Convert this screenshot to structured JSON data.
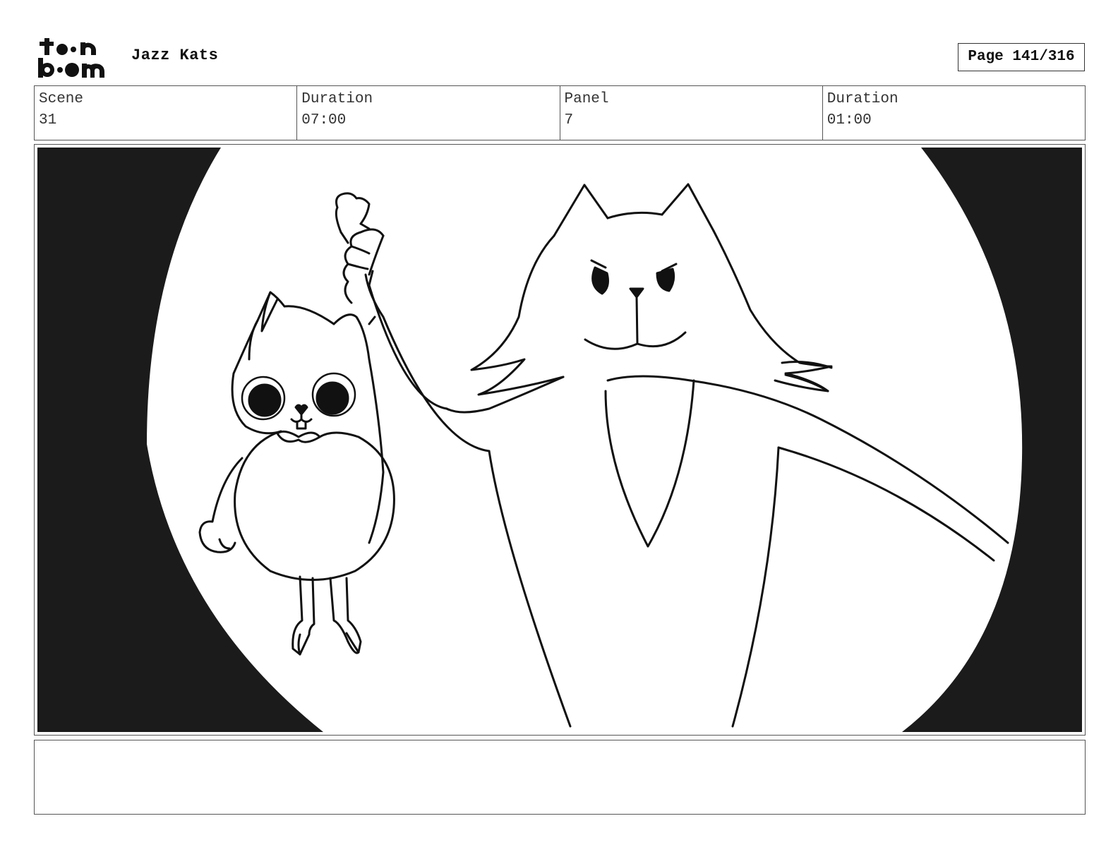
{
  "header": {
    "logo_text": "toon boom",
    "project_title": "Jazz Kats",
    "page_label": "Page 141/316"
  },
  "info": {
    "scene_label": "Scene",
    "scene_value": "31",
    "scene_duration_label": "Duration",
    "scene_duration_value": "07:00",
    "panel_label": "Panel",
    "panel_value": "7",
    "panel_duration_label": "Duration",
    "panel_duration_value": "01:00"
  },
  "notes": {
    "text": ""
  },
  "colors": {
    "ink": "#111111",
    "paper": "#ffffff",
    "border": "#555555"
  }
}
